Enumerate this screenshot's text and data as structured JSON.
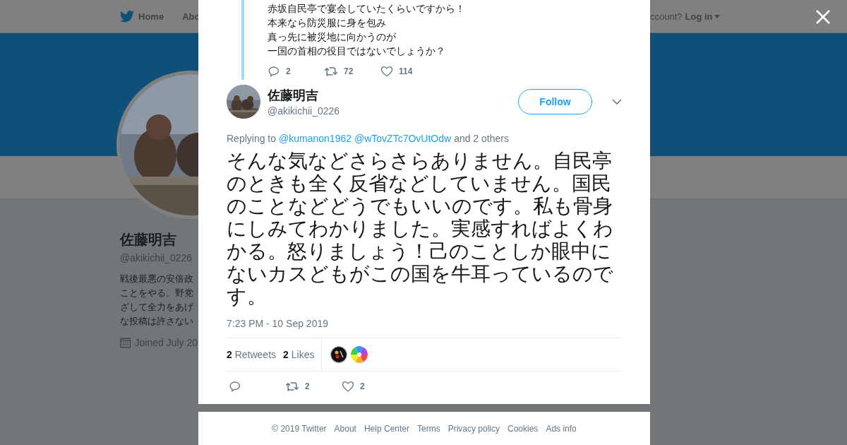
{
  "background": {
    "nav": [
      {
        "label": "Home",
        "selected": false
      },
      {
        "label": "Abo",
        "selected": false
      }
    ],
    "login_prompt": "ccount?",
    "login": "Log in",
    "profile": {
      "name": "佐藤明吉",
      "handle": "@akikichii_0226",
      "bio_lines": [
        "戦後最悪の安倍政",
        "ことをやる。野党",
        "ざして全力をあげ",
        "な投稿は許さない"
      ],
      "joined": "Joined July 20"
    }
  },
  "modal": {
    "parent_tweet": {
      "lines": [
        "赤坂自民亭で宴会していたくらいですから！",
        "本来なら防災服に身を包み",
        "真っ先に被災地に向かうのが",
        "一国の首相の役目ではないでしょうか？"
      ],
      "replies": "2",
      "retweets": "72",
      "likes": "114"
    },
    "tweet": {
      "name": "佐藤明吉",
      "handle": "@akikichii_0226",
      "follow": "Follow",
      "replying_label": "Replying to",
      "mentions": [
        "@kumanon1962",
        "@wTovZTc7OvUtOdw"
      ],
      "others": "and 2 others",
      "text": "そんな気などさらさらありません。自民亭のときも全く反省などしていません。国民のことなどどうでもいいのです。私も骨身にしみてわかりました。実感すればよくわかる。怒りましょう！己のことしか眼中にないカスどもがこの国を牛耳っているのです。",
      "time": "7:23 PM - 10 Sep 2019",
      "stats": [
        {
          "count": "2",
          "label": "Retweets"
        },
        {
          "count": "2",
          "label": "Likes"
        }
      ],
      "liker_avatars": [
        {
          "kind": "dark"
        },
        {
          "kind": "rainbow"
        }
      ],
      "retweets": "2",
      "likes": "2"
    }
  },
  "footer": [
    "© 2019 Twitter",
    "About",
    "Help Center",
    "Terms",
    "Privacy policy",
    "Cookies",
    "Ads info"
  ]
}
